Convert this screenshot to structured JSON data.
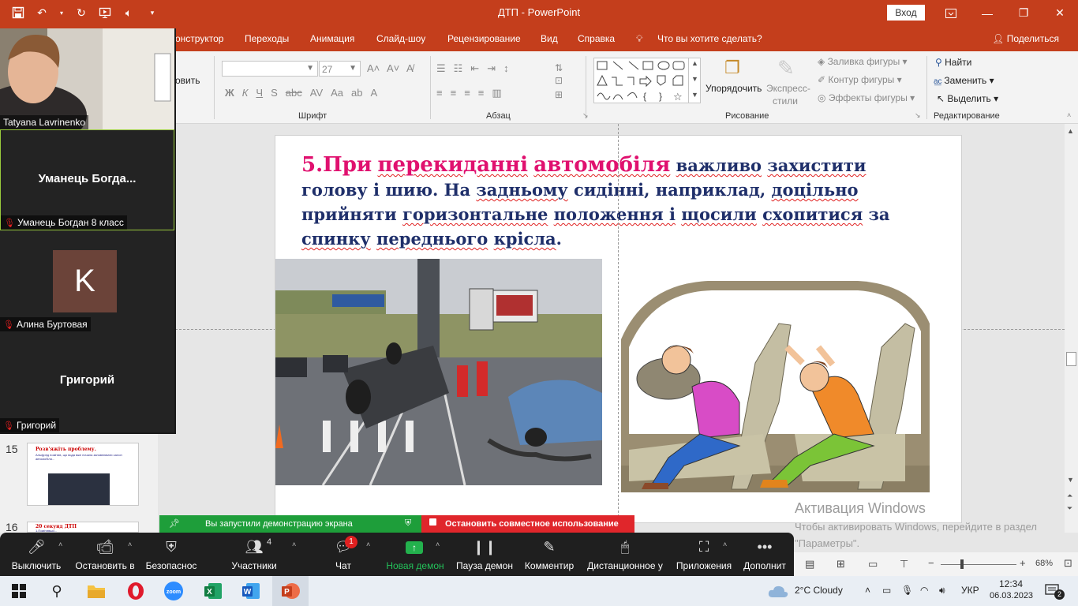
{
  "titlebar": {
    "doc_title": "ДТП  -  PowerPoint",
    "signin_label": "Вход"
  },
  "ribbon_tabs": [
    "онструктор",
    "Переходы",
    "Анимация",
    "Слайд-шоу",
    "Рецензирование",
    "Вид",
    "Справка"
  ],
  "tell_me": "Что вы хотите сделать?",
  "share_label": "Поделиться",
  "ribbon": {
    "new_slide_fragment": "овить",
    "font_size": "27",
    "group_font": "Шрифт",
    "group_paragraph": "Абзац",
    "group_drawing": "Рисование",
    "group_editing": "Редактирование",
    "arrange_label": "Упорядочить",
    "quick_styles_label_1": "Экспресс-",
    "quick_styles_label_2": "стили",
    "shape_fill": "Заливка фигуры",
    "shape_outline": "Контур фигуры",
    "shape_effects": "Эффекты фигуры",
    "find": "Найти",
    "replace": "Заменить",
    "select": "Выделить"
  },
  "slide": {
    "number_prefix": "5.",
    "pink_1": "При",
    "pink_2": "перекиданні",
    "pink_3": "автомобіля",
    "body_1": "важливо",
    "body_2": "захистити",
    "body_3": "голову і",
    "body_4": "шию. На",
    "body_5": "задньому",
    "body_6": "сидінні, наприклад,",
    "body_7": "доцільно",
    "body_8": "прийняти",
    "body_9": "горизонтальне",
    "body_10": "положення і",
    "body_11": "щосили",
    "body_12": "схопитися",
    "body_13": "за",
    "body_14": "спинку",
    "body_15": "переднього",
    "body_16": "крісла",
    "body_17": "."
  },
  "thumbnails": [
    {
      "number": "15",
      "title": "Розв'яжіть проблему.",
      "text": "Альфред помiтив, що вода вже почала заповнювати салон автомобiля..."
    },
    {
      "number": "16",
      "title": "20 секунд ДТП",
      "text": "1.Помiтивши..."
    }
  ],
  "watermark": {
    "title": "Активация Windows",
    "line": "Чтобы активировать Windows, перейдите в раздел \"Параметры\"."
  },
  "zoom": {
    "participants": [
      {
        "name": "Tatyana Lavrinenko",
        "center": ""
      },
      {
        "name": "Уманець Богдан 8 класс",
        "center": "Уманець  Богда..."
      },
      {
        "name": "Алина Буртовая",
        "center": "",
        "avatar_letter": "K"
      },
      {
        "name": "Григорий",
        "center": "Григорий"
      }
    ],
    "share_banner": "Вы запустили демонстрацию экрана",
    "stop_banner": "Остановить совместное использование",
    "toolbar": [
      {
        "label": "Выключить",
        "icon": "microphone-icon"
      },
      {
        "label": "Остановить в",
        "icon": "video-icon"
      },
      {
        "label": "Безопаснос",
        "icon": "shield-icon"
      },
      {
        "label": "Участники",
        "icon": "participants-icon",
        "count": "4"
      },
      {
        "label": "Чат",
        "icon": "chat-icon",
        "badge": "1"
      },
      {
        "label": "Новая демон",
        "icon": "share-screen-icon"
      },
      {
        "label": "Пауза демон",
        "icon": "pause-icon"
      },
      {
        "label": "Комментир",
        "icon": "pen-icon"
      },
      {
        "label": "Дистанционное у",
        "icon": "mouse-icon"
      },
      {
        "label": "Приложения",
        "icon": "apps-icon"
      },
      {
        "label": "Дополнит",
        "icon": "more-icon"
      }
    ]
  },
  "status": {
    "zoom_level": "68%"
  },
  "taskbar": {
    "weather": "2°C  Cloudy",
    "language": "УКР",
    "time": "12:34",
    "date": "06.03.2023",
    "notifications": "2"
  },
  "colors": {
    "ppt_accent": "#c43e1c",
    "slide_heading_pink": "#e0116f",
    "slide_body_navy": "#1f2f6a",
    "zoom_green": "#1e9e3a",
    "zoom_red": "#e0262b"
  }
}
